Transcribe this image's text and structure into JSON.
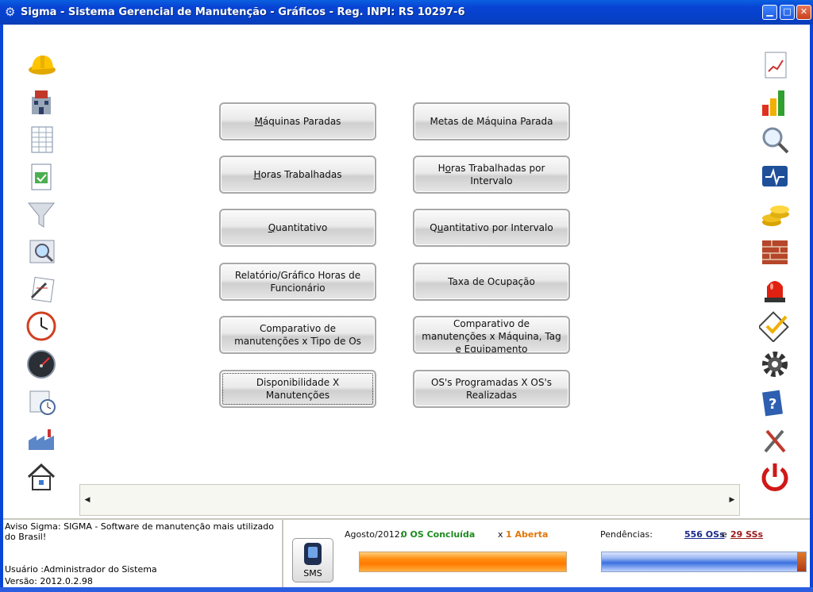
{
  "window": {
    "title": "Sigma - Sistema Gerencial de Manutenção - Gráficos - Reg. INPI: RS 10297-6",
    "controls": [
      "minimize",
      "maximize",
      "close"
    ]
  },
  "left_icons": [
    "hardhat-icon",
    "building-icon",
    "spreadsheet-icon",
    "checklist-report-icon",
    "filter-funnel-icon",
    "magnifier-report-icon",
    "notes-pencil-icon",
    "clock-icon",
    "speedometer-icon",
    "calendar-clock-icon",
    "factory-icon",
    "home-icon"
  ],
  "right_icons": [
    "chart-document-icon",
    "bar-chart-icon",
    "magnifier-icon",
    "monitor-heartbeat-icon",
    "coins-icon",
    "bricks-icon",
    "siren-icon",
    "checkmark-icon",
    "gear-icon",
    "help-book-icon",
    "tools-icon",
    "power-icon"
  ],
  "buttons": {
    "maquinas_paradas": {
      "accel": "M",
      "rest": "áquinas Paradas"
    },
    "metas_maquina_parada": "Metas de Máquina Parada",
    "horas_trabalhadas": {
      "accel": "H",
      "rest": "oras Trabalhadas"
    },
    "horas_trabalhadas_intervalo": {
      "pre": "H",
      "accel": "o",
      "rest": "ras Trabalhadas por Intervalo"
    },
    "quantitativo": {
      "accel": "Q",
      "rest": "uantitativo"
    },
    "quantitativo_intervalo": {
      "pre": "Q",
      "accel": "u",
      "rest": "antitativo por Intervalo"
    },
    "relatorio_horas_funcionario": "Relatório/Gráfico Horas de Funcionário",
    "taxa_ocupacao": "Taxa de Ocupação",
    "comparativo_tipo_os": "Comparativo de manutenções x Tipo de Os",
    "comparativo_maquina_tag": "Comparativo de manutenções x Máquina, Tag e Equipamento",
    "disponibilidade_manutencoes": "Disponibilidade X Manutenções",
    "os_programadas_realizadas": "OS's Programadas X OS's Realizadas"
  },
  "status": {
    "notice": "Aviso Sigma: SIGMA - Software de manutenção mais utilizado do Brasil!",
    "user": "Usuário :Administrador do Sistema",
    "version": "Versão: 2012.0.2.98",
    "sms_label": "SMS",
    "period": "Agosto/2012:",
    "concluida": "0 OS Concluída",
    "x": "x",
    "aberta": "1 Aberta",
    "pendencias_label": "Pendências:",
    "oss": "556 OSs",
    "e": "e",
    "sss": "29 SSs"
  },
  "colors": {
    "titlebar": "#0843d4",
    "concluida": "#1e8a1e",
    "aberta": "#e0760a",
    "oss": "#1a2a8a",
    "sss": "#9a1a1a"
  }
}
